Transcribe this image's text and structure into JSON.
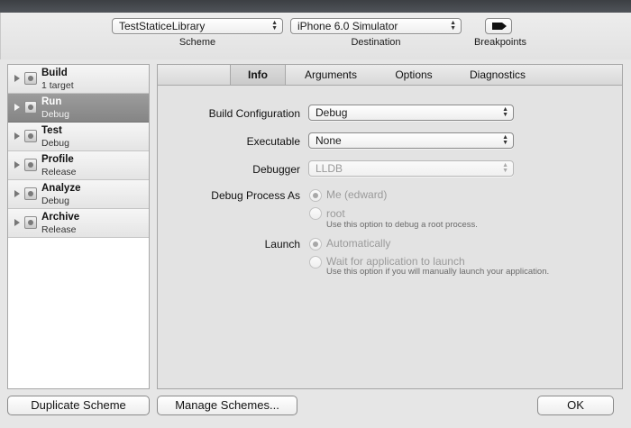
{
  "toolbar": {
    "scheme": {
      "value": "TestStaticeLibrary",
      "label": "Scheme"
    },
    "destination": {
      "value": "iPhone 6.0 Simulator",
      "label": "Destination"
    },
    "breakpoints": {
      "label": "Breakpoints"
    }
  },
  "actions": [
    {
      "name": "Build",
      "sub": "1 target",
      "icon": "build-icon"
    },
    {
      "name": "Run",
      "sub": "Debug",
      "icon": "run-icon"
    },
    {
      "name": "Test",
      "sub": "Debug",
      "icon": "test-icon"
    },
    {
      "name": "Profile",
      "sub": "Release",
      "icon": "profile-icon"
    },
    {
      "name": "Analyze",
      "sub": "Debug",
      "icon": "analyze-icon"
    },
    {
      "name": "Archive",
      "sub": "Release",
      "icon": "archive-icon"
    }
  ],
  "tabs": [
    "Info",
    "Arguments",
    "Options",
    "Diagnostics"
  ],
  "info": {
    "build_configuration": {
      "label": "Build Configuration",
      "value": "Debug"
    },
    "executable": {
      "label": "Executable",
      "value": "None"
    },
    "debugger": {
      "label": "Debugger",
      "value": "LLDB"
    },
    "debug_process_as": {
      "label": "Debug Process As",
      "me": "Me (edward)",
      "root": "root",
      "root_hint": "Use this option to debug a root process."
    },
    "launch": {
      "label": "Launch",
      "automatically": "Automatically",
      "wait": "Wait for application to launch",
      "wait_hint": "Use this option if you will manually launch your application."
    }
  },
  "buttons": {
    "duplicate": "Duplicate Scheme",
    "manage": "Manage Schemes...",
    "ok": "OK"
  },
  "colors": {
    "selected_row": "#8f8f8f",
    "panel_bg": "#e3e3e3"
  }
}
